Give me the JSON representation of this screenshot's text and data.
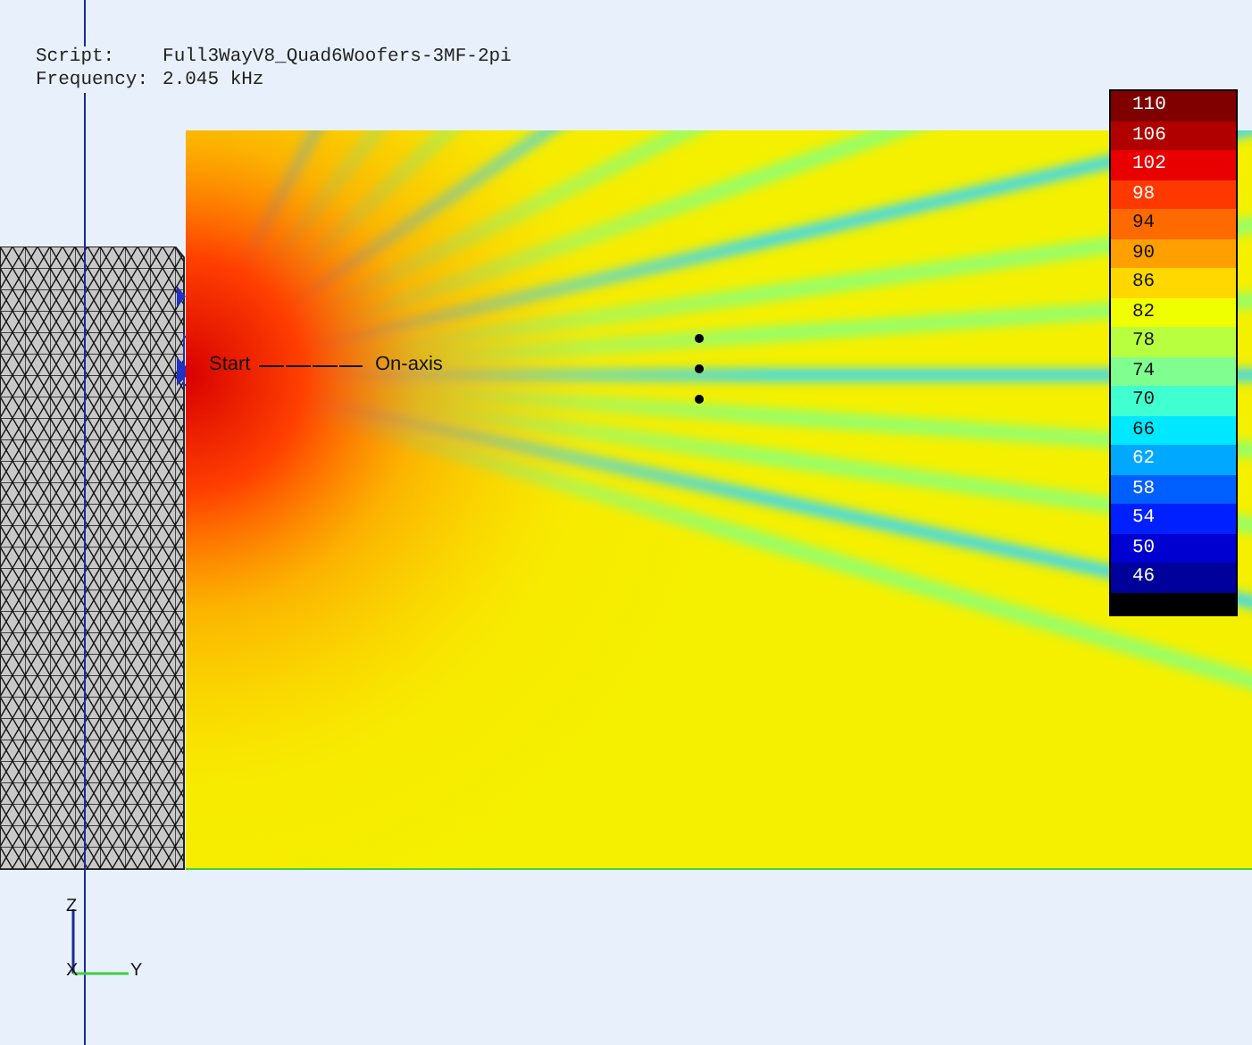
{
  "info": {
    "script_label": "Script:",
    "script": "Full3WayV8_Quad6Woofers-3MF-2pi",
    "frequency_label": "Frequency:",
    "frequency": "2.045 kHz"
  },
  "legend": [
    {
      "label": "110",
      "color": "#800000"
    },
    {
      "label": "106",
      "color": "#b00000"
    },
    {
      "label": "102",
      "color": "#e80000"
    },
    {
      "label": "98",
      "color": "#ff3800"
    },
    {
      "label": "94",
      "color": "#ff6a00"
    },
    {
      "label": "90",
      "color": "#ffa000"
    },
    {
      "label": "86",
      "color": "#ffd800"
    },
    {
      "label": "82",
      "color": "#f0ff00"
    },
    {
      "label": "78",
      "color": "#b8ff40"
    },
    {
      "label": "74",
      "color": "#80ff90"
    },
    {
      "label": "70",
      "color": "#40ffd0"
    },
    {
      "label": "66",
      "color": "#00e8ff"
    },
    {
      "label": "62",
      "color": "#00a8ff"
    },
    {
      "label": "58",
      "color": "#0060ff"
    },
    {
      "label": "54",
      "color": "#0020ff"
    },
    {
      "label": "50",
      "color": "#0000d0"
    },
    {
      "label": "46",
      "color": "#00009a"
    }
  ],
  "markers": {
    "start": "Start",
    "end": "On-axis"
  },
  "axes": {
    "z": "Z",
    "x": "X",
    "y": "Y"
  }
}
